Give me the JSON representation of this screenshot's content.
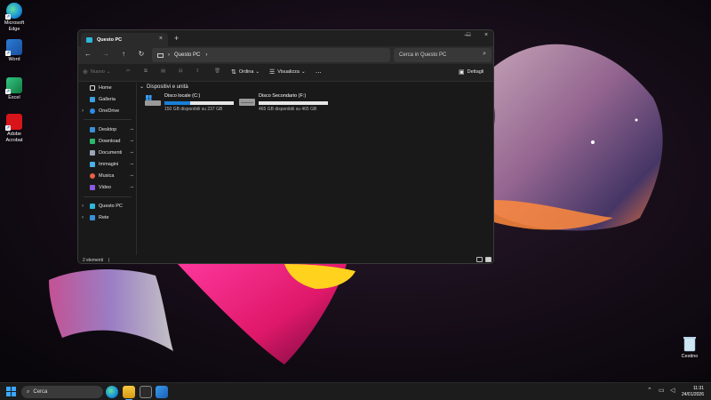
{
  "desktop": {
    "icons": [
      {
        "label": "Microsoft Edge",
        "icon": "edge-icon"
      },
      {
        "label": "Word",
        "icon": "word-icon"
      },
      {
        "label": "Excel",
        "icon": "excel-icon"
      },
      {
        "label": "Adobe Acrobat",
        "icon": "acrobat-icon"
      }
    ],
    "recycle_bin_label": "Cestino"
  },
  "explorer": {
    "tab_title": "Questo PC",
    "address": {
      "path_label": "Questo PC",
      "search_placeholder": "Cerca in Questo PC"
    },
    "toolbar": {
      "new_label": "Nuovo",
      "sort_label": "Ordina",
      "view_label": "Visualizza",
      "more_label": "...",
      "details_label": "Dettagli"
    },
    "sidebar": {
      "items": [
        {
          "label": "Home",
          "icon": "home-icon"
        },
        {
          "label": "Galleria",
          "icon": "gallery-icon"
        },
        {
          "label": "OneDrive",
          "icon": "onedrive-icon"
        },
        {
          "label": "Desktop",
          "icon": "desktop-icon"
        },
        {
          "label": "Download",
          "icon": "download-icon"
        },
        {
          "label": "Documenti",
          "icon": "documents-icon"
        },
        {
          "label": "Immagini",
          "icon": "pictures-icon"
        },
        {
          "label": "Musica",
          "icon": "music-icon"
        },
        {
          "label": "Video",
          "icon": "video-icon"
        },
        {
          "label": "Questo PC",
          "icon": "this-pc-icon"
        },
        {
          "label": "Rete",
          "icon": "network-icon"
        }
      ]
    },
    "content": {
      "group_title": "Dispositivi e unità",
      "drives": [
        {
          "name": "Disco locale (C:)",
          "info": "150 GB disponibili su 237 GB",
          "used_fraction": 0.37
        },
        {
          "name": "Disco Secondario (F:)",
          "info": "465 GB disponibili su 465 GB",
          "used_fraction": 0.0
        }
      ]
    },
    "status": {
      "items_count": "2 elementi"
    }
  },
  "taskbar": {
    "search_placeholder": "Cerca",
    "time": "11:31",
    "date": "24/01/2026"
  },
  "colors": {
    "accent": "#1a7fd8",
    "window_bg": "#191919",
    "taskbar_bg": "#1c1c1c"
  }
}
